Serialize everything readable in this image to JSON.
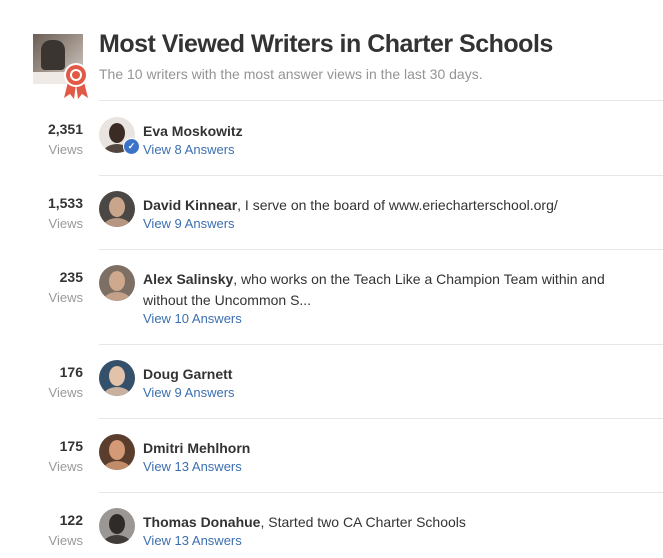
{
  "header": {
    "title": "Most Viewed Writers in Charter Schools",
    "subtitle": "The 10 writers with the most answer views in the last 30 days."
  },
  "writers": [
    {
      "views": "2,351",
      "views_label": "Views",
      "name": "Eva Moskowitz",
      "tagline": "",
      "link": "View 8 Answers",
      "verified": true,
      "avatar_colors": [
        "#e9e4df",
        "#3a2b24"
      ]
    },
    {
      "views": "1,533",
      "views_label": "Views",
      "name": "David Kinnear",
      "tagline": ", I serve on the board of www.eriecharterschool.org/",
      "link": "View 9 Answers",
      "verified": false,
      "avatar_colors": [
        "#4a4744",
        "#c9a58c"
      ]
    },
    {
      "views": "235",
      "views_label": "Views",
      "name": "Alex Salinsky",
      "tagline": ", who works on the Teach Like a Champion Team within and without the Uncommon S...",
      "link": "View 10 Answers",
      "verified": false,
      "avatar_colors": [
        "#7d6f64",
        "#cfa98e"
      ]
    },
    {
      "views": "176",
      "views_label": "Views",
      "name": "Doug Garnett",
      "tagline": "",
      "link": "View 9 Answers",
      "verified": false,
      "avatar_colors": [
        "#35506b",
        "#e2c2a8"
      ]
    },
    {
      "views": "175",
      "views_label": "Views",
      "name": "Dmitri Mehlhorn",
      "tagline": "",
      "link": "View 13 Answers",
      "verified": false,
      "avatar_colors": [
        "#5a3d2c",
        "#d49a76"
      ]
    },
    {
      "views": "122",
      "views_label": "Views",
      "name": "Thomas Donahue",
      "tagline": ", Started two CA Charter Schools",
      "link": "View 13 Answers",
      "verified": false,
      "avatar_colors": [
        "#9a9795",
        "#2f2b29"
      ]
    }
  ]
}
